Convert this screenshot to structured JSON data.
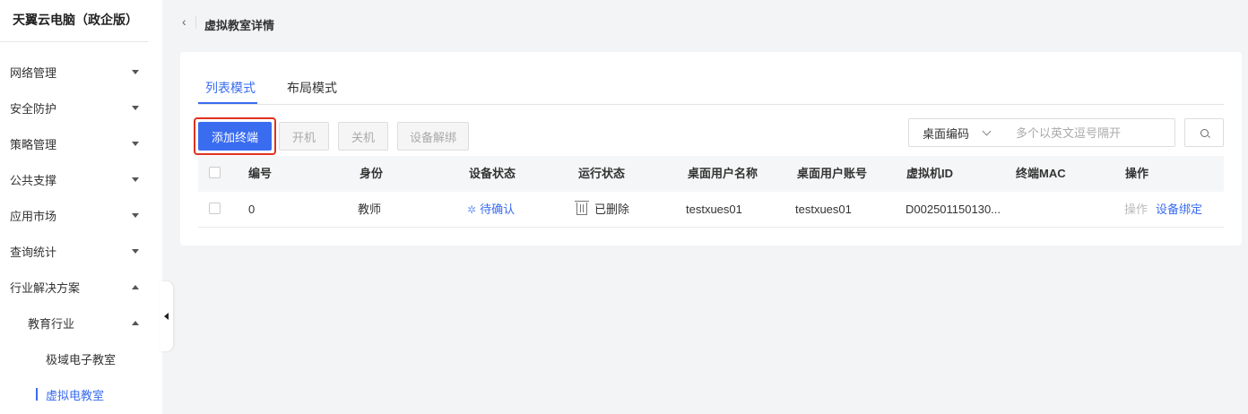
{
  "app_title": "天翼云电脑（政企版）",
  "sidebar": {
    "items": [
      {
        "label": "网络管理",
        "expanded": false
      },
      {
        "label": "安全防护",
        "expanded": false
      },
      {
        "label": "策略管理",
        "expanded": false
      },
      {
        "label": "公共支撑",
        "expanded": false
      },
      {
        "label": "应用市场",
        "expanded": false
      },
      {
        "label": "查询统计",
        "expanded": false
      },
      {
        "label": "行业解决方案",
        "expanded": true
      }
    ],
    "sub_group": {
      "label": "教育行业",
      "expanded": true
    },
    "leaves": [
      {
        "label": "极域电子教室",
        "active": false
      },
      {
        "label": "虚拟电教室",
        "active": true
      }
    ]
  },
  "header": {
    "back_icon": "chevron-left-icon",
    "title": "虚拟教室详情"
  },
  "tabs": [
    {
      "label": "列表模式",
      "active": true
    },
    {
      "label": "布局模式",
      "active": false
    }
  ],
  "toolbar": {
    "add_terminal": "添加终端",
    "power_on": "开机",
    "power_off": "关机",
    "unbind_device": "设备解绑"
  },
  "search": {
    "filter_selected": "桌面编码",
    "placeholder": "多个以英文逗号隔开",
    "value": ""
  },
  "table": {
    "columns": [
      "编号",
      "身份",
      "设备状态",
      "运行状态",
      "桌面用户名称",
      "桌面用户账号",
      "虚拟机ID",
      "终端MAC",
      "操作"
    ],
    "rows": [
      {
        "number": "0",
        "identity": "教师",
        "device_status": "待确认",
        "run_status": "已删除",
        "desktop_user_name": "testxues01",
        "desktop_user_account": "testxues01",
        "vm_id": "D002501150130...",
        "terminal_mac": "",
        "action_operate": "操作",
        "action_bind": "设备绑定"
      }
    ]
  },
  "colors": {
    "accent": "#3a6cf0",
    "highlight": "#e0321e"
  }
}
